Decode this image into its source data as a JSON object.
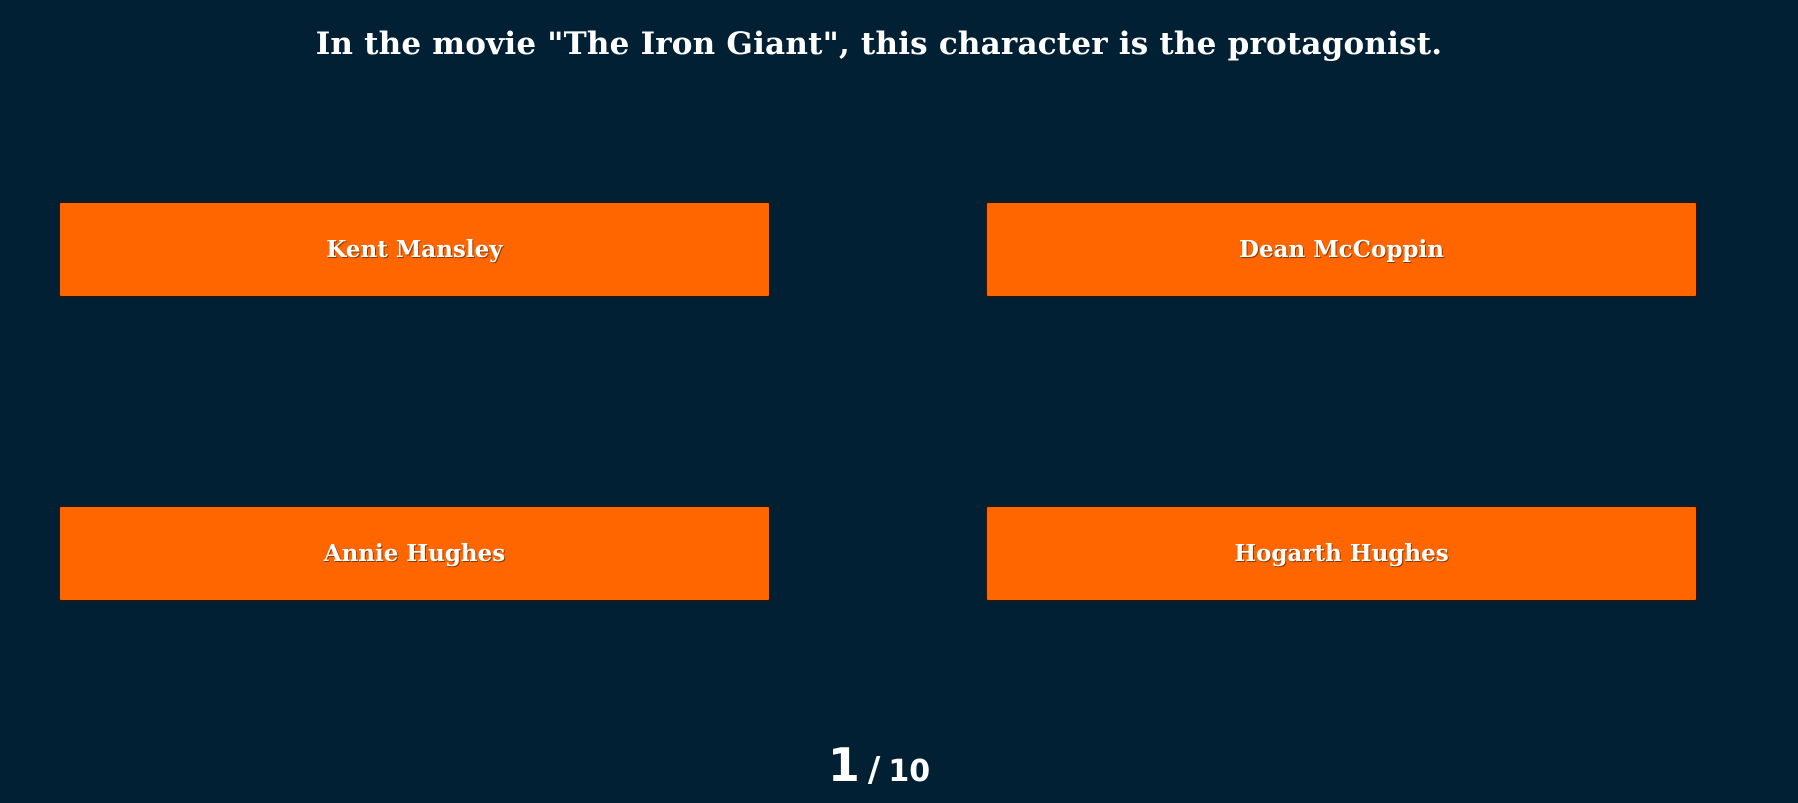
{
  "quiz": {
    "question": "In the movie \"The Iron Giant\", this character is the protagonist.",
    "answers": [
      {
        "label": "Kent Mansley"
      },
      {
        "label": "Dean McCoppin"
      },
      {
        "label": "Annie Hughes"
      },
      {
        "label": "Hogarth Hughes"
      }
    ],
    "progress": {
      "current": "1",
      "separator": "/",
      "total": "10"
    }
  },
  "colors": {
    "background": "#022033",
    "answer_button": "#ff6600",
    "text": "#ffffff"
  }
}
